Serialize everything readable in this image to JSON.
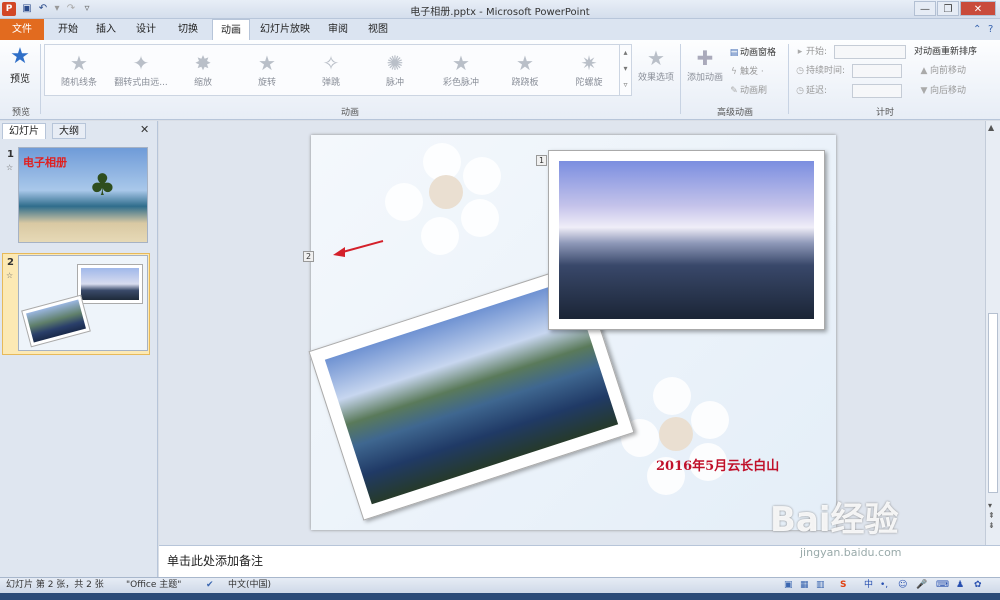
{
  "window": {
    "app_icon": "P",
    "title": "电子相册.pptx - Microsoft PowerPoint",
    "controls": {
      "minimize": "—",
      "maximize": "❐",
      "close": "✕"
    }
  },
  "tabs": {
    "file": "文件",
    "items": [
      "开始",
      "插入",
      "设计",
      "切换",
      "动画",
      "幻灯片放映",
      "审阅",
      "视图"
    ],
    "active": "动画"
  },
  "ribbon": {
    "preview": {
      "label": "预览",
      "group": "预览"
    },
    "animation_group_label": "动画",
    "animations": [
      {
        "label": "随机线条",
        "icon": "★"
      },
      {
        "label": "翻转式由远...",
        "icon": "✦"
      },
      {
        "label": "缩放",
        "icon": "✸"
      },
      {
        "label": "旋转",
        "icon": "★"
      },
      {
        "label": "弹跳",
        "icon": "✧"
      },
      {
        "label": "脉冲",
        "icon": "✺"
      },
      {
        "label": "彩色脉冲",
        "icon": "★"
      },
      {
        "label": "跷跷板",
        "icon": "★"
      },
      {
        "label": "陀螺旋",
        "icon": "✷"
      }
    ],
    "effect_options": "效果选项",
    "add_animation": "添加动画",
    "animation_pane": "动画窗格",
    "trigger": "触发 ·",
    "painter": "动画刷",
    "advanced_group_label": "高级动画",
    "start": "开始:",
    "duration": "持续时间:",
    "delay": "延迟:",
    "reorder_title": "对动画重新排序",
    "move_earlier": "向前移动",
    "move_later": "向后移动",
    "timing_group_label": "计时"
  },
  "left_pane": {
    "tab_slides": "幻灯片",
    "tab_outline": "大纲",
    "close": "✕",
    "slide1_num": "1",
    "slide1_title": "电子相册",
    "slide2_num": "2"
  },
  "slide": {
    "marker1": "1",
    "marker2": "2",
    "caption": "2016年5月云长白山"
  },
  "notes": {
    "placeholder": "单击此处添加备注"
  },
  "status": {
    "slide_info": "幻灯片 第 2 张，共 2 张",
    "theme": "\"Office 主题\"",
    "language": "中文(中国)"
  },
  "watermark": {
    "brand": "Bai经验",
    "url": "jingyan.baidu.com"
  },
  "colors": {
    "file_tab": "#e26b1f",
    "caption": "#c0102a",
    "arrow": "#d4202a"
  }
}
